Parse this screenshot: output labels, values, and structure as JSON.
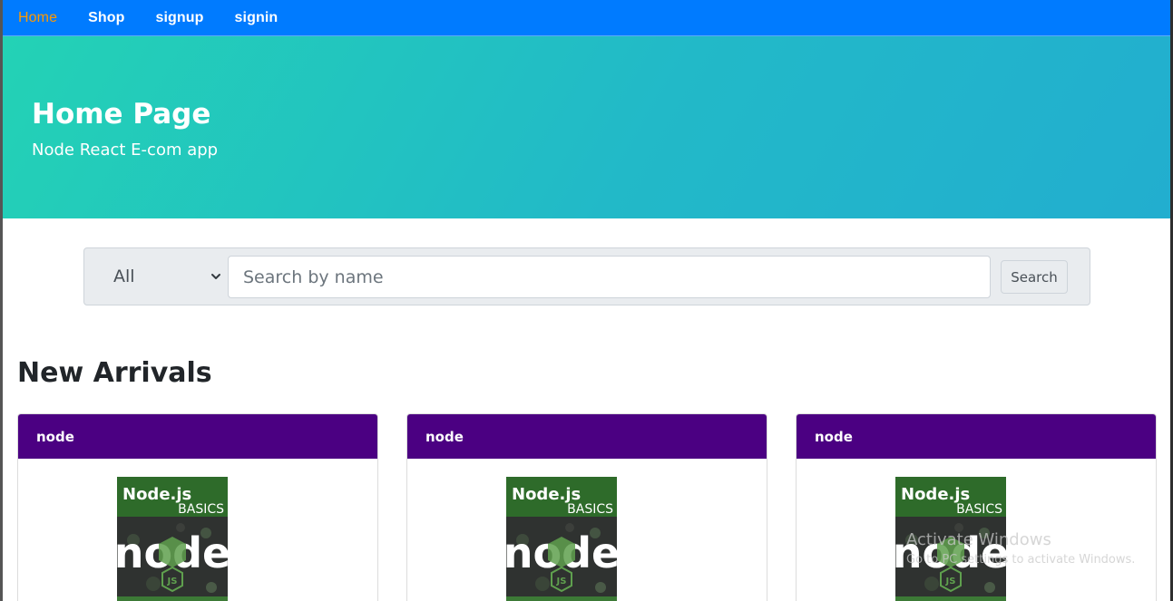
{
  "nav": {
    "items": [
      {
        "label": "Home",
        "active": true
      },
      {
        "label": "Shop",
        "active": false
      },
      {
        "label": "signup",
        "active": false
      },
      {
        "label": "signin",
        "active": false
      }
    ]
  },
  "hero": {
    "title": "Home Page",
    "subtitle": "Node React E-com app"
  },
  "search": {
    "category_selected": "All",
    "placeholder": "Search by name",
    "value": "",
    "button_label": "Search"
  },
  "new_arrivals": {
    "title": "New Arrivals",
    "products": [
      {
        "name": "node",
        "image": {
          "title": "Node.js",
          "subtitle": "BASICS",
          "logo": "node",
          "badge": "JS"
        }
      },
      {
        "name": "node",
        "image": {
          "title": "Node.js",
          "subtitle": "BASICS",
          "logo": "node",
          "badge": "JS"
        }
      },
      {
        "name": "node",
        "image": {
          "title": "Node.js",
          "subtitle": "BASICS",
          "logo": "node",
          "badge": "JS"
        }
      }
    ]
  },
  "system_overlay": {
    "title": "Activate Windows",
    "message": "Go to PC settings to activate Windows."
  },
  "colors": {
    "navbar": "#007bff",
    "nav_active": "#ff9900",
    "hero_start": "#23d2b5",
    "hero_end": "#22aecf",
    "card_header": "#4b0082",
    "node_green": "#5fa04e"
  },
  "icons": {
    "select_arrow": "chevron-down-icon"
  }
}
